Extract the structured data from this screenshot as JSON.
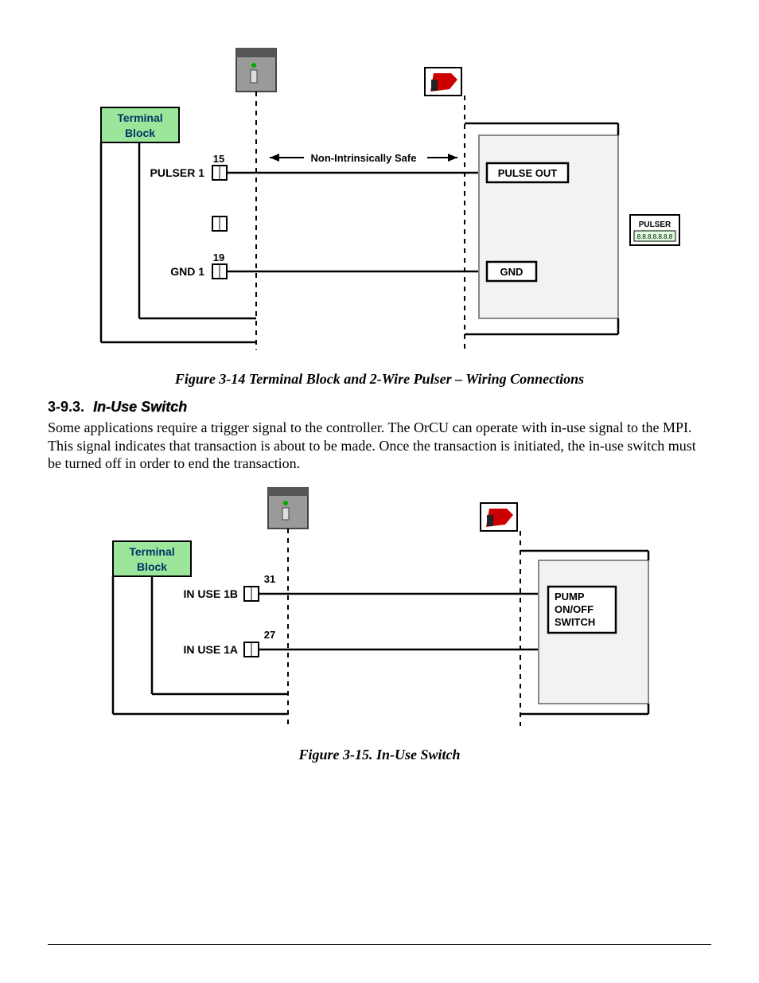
{
  "figure1": {
    "caption": "Figure 3-14  Terminal Block and 2-Wire Pulser – Wiring Connections",
    "terminal_block_label1": "Terminal",
    "terminal_block_label2": "Block",
    "pulser1": "PULSER 1",
    "gnd1": "GND 1",
    "pin15": "15",
    "pin19": "19",
    "safety_label": "Non-Intrinsically Safe",
    "pulse_out": "PULSE OUT",
    "gnd": "GND",
    "pulser_label": "PULSER",
    "pulser_digits": "8.8.8.8.8.8.8"
  },
  "section": {
    "number": "3-9.3.",
    "title": "In-Use Switch",
    "body": "Some applications require a trigger signal to the controller. The OrCU can operate with in-use signal to the MPI. This signal indicates that transaction is about to be made. Once the transaction is initiated, the in-use switch must be turned off in order to end the transaction."
  },
  "figure2": {
    "caption": "Figure 3-15. In-Use Switch",
    "terminal_block_label1": "Terminal",
    "terminal_block_label2": "Block",
    "in_use_1b": "IN USE 1B",
    "in_use_1a": "IN USE 1A",
    "pin31": "31",
    "pin27": "27",
    "pump_label1": "PUMP",
    "pump_label2": "ON/OFF",
    "pump_label3": "SWITCH"
  }
}
